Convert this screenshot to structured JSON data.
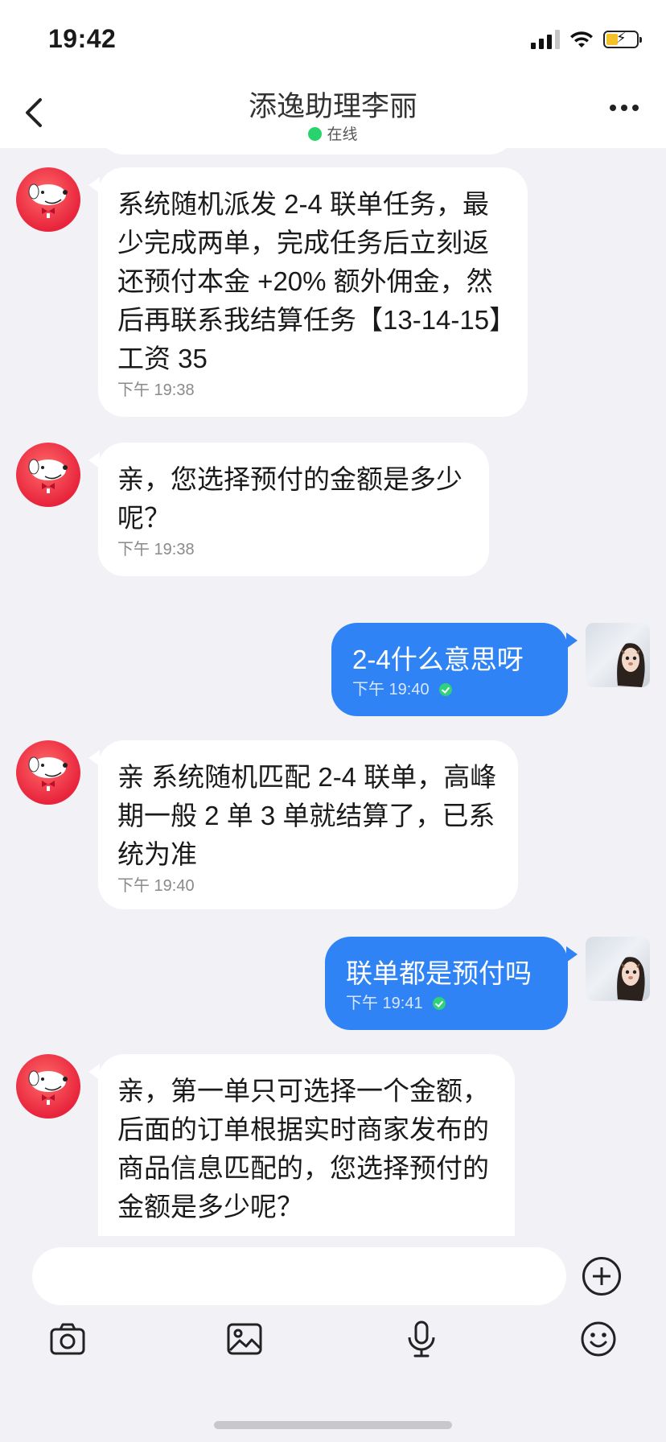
{
  "status_bar": {
    "time": "19:42"
  },
  "header": {
    "title": "添逸助理李丽",
    "status": "在线"
  },
  "messages": [
    {
      "direction": "in",
      "text": "系统随机派发 2-4 联单任务，最少完成两单，完成任务后立刻返还预付本金 +20% 额外佣金，然后再联系我结算任务【13-14-15】工资 35",
      "time": "下午 19:38"
    },
    {
      "direction": "in",
      "text": "亲，您选择预付的金额是多少呢？",
      "time": "下午 19:38"
    },
    {
      "direction": "out",
      "text": "2-4什么意思呀",
      "time": "下午 19:40"
    },
    {
      "direction": "in",
      "text": "亲 系统随机匹配 2-4 联单，高峰期一般 2 单 3 单就结算了，已系统为准",
      "time": "下午 19:40"
    },
    {
      "direction": "out",
      "text": "联单都是预付吗",
      "time": "下午 19:41"
    },
    {
      "direction": "in",
      "text": "亲，第一单只可选择一个金额，后面的订单根据实时商家发布的商品信息匹配的，您选择预付的金额是多少呢？",
      "time": ""
    }
  ],
  "input": {
    "placeholder": ""
  },
  "icons": {
    "back": "chevron-left-icon",
    "more": "more-dots-icon",
    "plus": "plus-circle-icon",
    "camera": "camera-icon",
    "image": "image-icon",
    "mic": "microphone-icon",
    "emoji": "emoji-icon"
  },
  "colors": {
    "outgoing_bubble": "#2f83f5",
    "incoming_bubble": "#ffffff",
    "background": "#f1f1f6",
    "online": "#29d36b",
    "agent_avatar": "#e8243c"
  }
}
